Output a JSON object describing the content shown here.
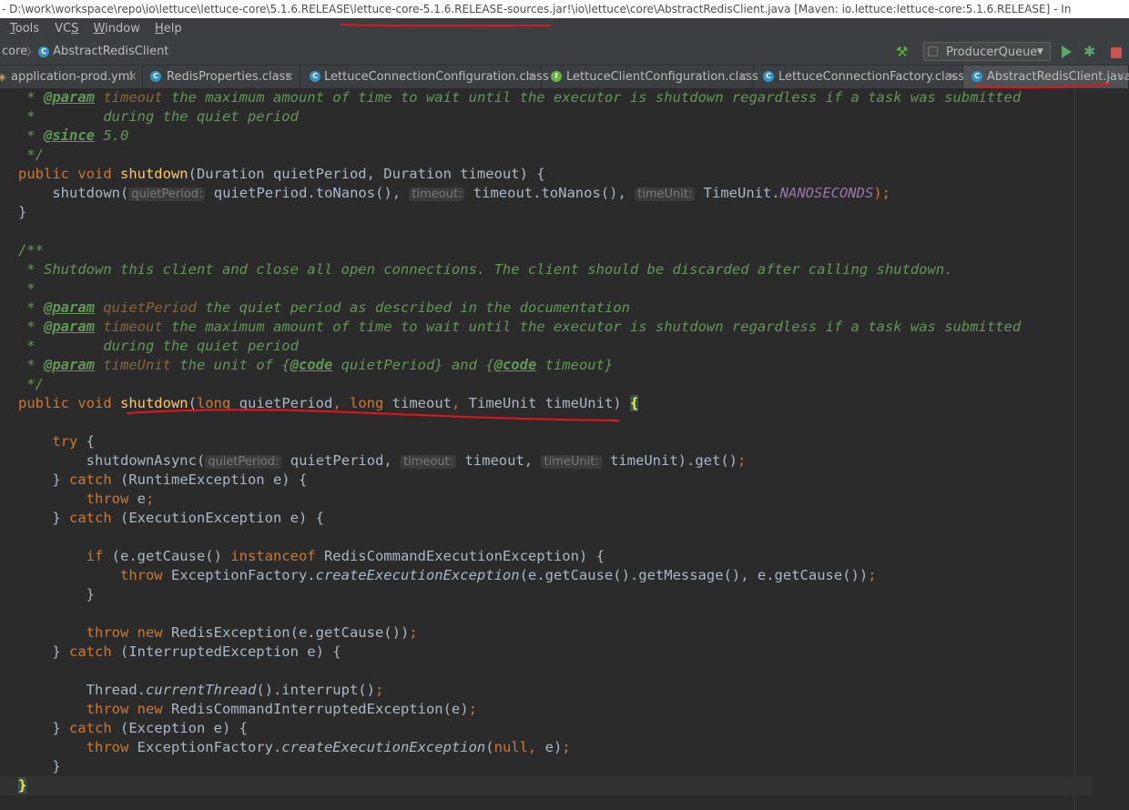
{
  "window": {
    "title": "- D:\\work\\workspace\\repo\\io\\lettuce\\lettuce-core\\5.1.6.RELEASE\\lettuce-core-5.1.6.RELEASE-sources.jar!\\io\\lettuce\\core\\AbstractRedisClient.java [Maven: io.lettuce:lettuce-core:5.1.6.RELEASE] - In"
  },
  "menu": {
    "items": [
      {
        "mnemonic": "T",
        "rest": "ools"
      },
      {
        "mnemonic": "",
        "rest": "VC",
        "tail": "S",
        "tail_underlined": true
      },
      {
        "mnemonic": "W",
        "rest": "indow"
      },
      {
        "mnemonic": "H",
        "rest": "elp"
      }
    ]
  },
  "navbar": {
    "crumb_project": "core",
    "crumb_separator": "〉",
    "crumb_class": "AbstractRedisClient",
    "run_config": "ProducerQueue"
  },
  "tabs": [
    {
      "label": "application-prod.yml",
      "active": false,
      "icon": "yaml-icon"
    },
    {
      "label": "RedisProperties.class",
      "active": false,
      "icon": "class-icon"
    },
    {
      "label": "LettuceConnectionConfiguration.class",
      "active": false,
      "icon": "class-icon"
    },
    {
      "label": "LettuceClientConfiguration.class",
      "active": false,
      "icon": "interface-icon"
    },
    {
      "label": "LettuceConnectionFactory.class",
      "active": false,
      "icon": "class-icon"
    },
    {
      "label": "AbstractRedisClient.java",
      "active": true,
      "icon": "class-icon"
    }
  ],
  "tab_close_glyph": "×",
  "code": [
    [
      {
        "t": " * ",
        "c": "doc"
      },
      {
        "t": "@param",
        "c": "tag"
      },
      {
        "t": " ",
        "c": "doc"
      },
      {
        "t": "timeout",
        "c": "param"
      },
      {
        "t": " the maximum amount of time to wait until the executor is shutdown regardless if a task was submitted",
        "c": "doc"
      }
    ],
    [
      {
        "t": " *        during the quiet period",
        "c": "doc"
      }
    ],
    [
      {
        "t": " * ",
        "c": "doc"
      },
      {
        "t": "@since",
        "c": "tag"
      },
      {
        "t": " 5.0",
        "c": "doc"
      }
    ],
    [
      {
        "t": " */",
        "c": "doc"
      }
    ],
    [
      {
        "t": "public void ",
        "c": "kw"
      },
      {
        "t": "shutdown",
        "c": "method"
      },
      {
        "t": "(Duration quietPeriod, Duration timeout) {",
        "c": "plain"
      }
    ],
    [
      {
        "t": "    shutdown(",
        "c": "plain"
      },
      {
        "t": "quietPeriod:",
        "c": "hint"
      },
      {
        "t": " quietPeriod.toNanos(), ",
        "c": "plain"
      },
      {
        "t": "timeout:",
        "c": "hint"
      },
      {
        "t": " timeout.toNanos(), ",
        "c": "plain"
      },
      {
        "t": "timeUnit:",
        "c": "hint"
      },
      {
        "t": " TimeUnit.",
        "c": "plain"
      },
      {
        "t": "NANOSECONDS",
        "c": "static"
      },
      {
        "t": ");",
        "c": "kw"
      }
    ],
    [
      {
        "t": "}",
        "c": "plain"
      }
    ],
    [
      {
        "t": "",
        "c": "plain"
      }
    ],
    [
      {
        "t": "/**",
        "c": "doc"
      }
    ],
    [
      {
        "t": " * Shutdown this client and close all open connections. The client should be discarded after calling shutdown.",
        "c": "doc"
      }
    ],
    [
      {
        "t": " *",
        "c": "doc"
      }
    ],
    [
      {
        "t": " * ",
        "c": "doc"
      },
      {
        "t": "@param",
        "c": "tag"
      },
      {
        "t": " ",
        "c": "doc"
      },
      {
        "t": "quietPeriod",
        "c": "param"
      },
      {
        "t": " the quiet period as described in the documentation",
        "c": "doc"
      }
    ],
    [
      {
        "t": " * ",
        "c": "doc"
      },
      {
        "t": "@param",
        "c": "tag"
      },
      {
        "t": " ",
        "c": "doc"
      },
      {
        "t": "timeout",
        "c": "param"
      },
      {
        "t": " the maximum amount of time to wait until the executor is shutdown regardless if a task was submitted",
        "c": "doc"
      }
    ],
    [
      {
        "t": " *        during the quiet period",
        "c": "doc"
      }
    ],
    [
      {
        "t": " * ",
        "c": "doc"
      },
      {
        "t": "@param",
        "c": "tag"
      },
      {
        "t": " ",
        "c": "doc"
      },
      {
        "t": "timeUnit",
        "c": "param"
      },
      {
        "t": " the unit of {",
        "c": "doc"
      },
      {
        "t": "@code",
        "c": "tag"
      },
      {
        "t": " quietPeriod} and {",
        "c": "doc"
      },
      {
        "t": "@code",
        "c": "tag"
      },
      {
        "t": " timeout}",
        "c": "doc"
      }
    ],
    [
      {
        "t": " */",
        "c": "doc"
      }
    ],
    [
      {
        "t": "public void ",
        "c": "kw"
      },
      {
        "t": "shutdown",
        "c": "method"
      },
      {
        "t": "(",
        "c": "plain"
      },
      {
        "t": "long ",
        "c": "kw"
      },
      {
        "t": "quietPeriod",
        "c": "plain"
      },
      {
        "t": ", ",
        "c": "kw"
      },
      {
        "t": "long ",
        "c": "kw"
      },
      {
        "t": "timeout",
        "c": "plain"
      },
      {
        "t": ", ",
        "c": "kw"
      },
      {
        "t": "TimeUnit timeUnit) ",
        "c": "plain"
      },
      {
        "t": "{",
        "c": "brace"
      }
    ],
    [
      {
        "t": "",
        "c": "plain"
      }
    ],
    [
      {
        "t": "    ",
        "c": "plain"
      },
      {
        "t": "try ",
        "c": "kw"
      },
      {
        "t": "{",
        "c": "plain"
      }
    ],
    [
      {
        "t": "        shutdownAsync(",
        "c": "plain"
      },
      {
        "t": "quietPeriod:",
        "c": "hint"
      },
      {
        "t": " quietPeriod, ",
        "c": "plain"
      },
      {
        "t": "timeout:",
        "c": "hint"
      },
      {
        "t": " timeout, ",
        "c": "plain"
      },
      {
        "t": "timeUnit:",
        "c": "hint"
      },
      {
        "t": " timeUnit).get()",
        "c": "plain"
      },
      {
        "t": ";",
        "c": "kw"
      }
    ],
    [
      {
        "t": "    } ",
        "c": "plain"
      },
      {
        "t": "catch ",
        "c": "kw"
      },
      {
        "t": "(RuntimeException e) {",
        "c": "plain"
      }
    ],
    [
      {
        "t": "        ",
        "c": "plain"
      },
      {
        "t": "throw ",
        "c": "kw"
      },
      {
        "t": "e",
        "c": "plain"
      },
      {
        "t": ";",
        "c": "kw"
      }
    ],
    [
      {
        "t": "    } ",
        "c": "plain"
      },
      {
        "t": "catch ",
        "c": "kw"
      },
      {
        "t": "(ExecutionException e) {",
        "c": "plain"
      }
    ],
    [
      {
        "t": "",
        "c": "plain"
      }
    ],
    [
      {
        "t": "        ",
        "c": "plain"
      },
      {
        "t": "if ",
        "c": "kw"
      },
      {
        "t": "(e.getCause() ",
        "c": "plain"
      },
      {
        "t": "instanceof ",
        "c": "kw"
      },
      {
        "t": "RedisCommandExecutionException) {",
        "c": "plain"
      }
    ],
    [
      {
        "t": "            ",
        "c": "plain"
      },
      {
        "t": "throw ",
        "c": "kw"
      },
      {
        "t": "ExceptionFactory.",
        "c": "plain"
      },
      {
        "t": "createExecutionException",
        "c": "italic"
      },
      {
        "t": "(e.getCause().getMessage(), e.getCause())",
        "c": "plain"
      },
      {
        "t": ";",
        "c": "kw"
      }
    ],
    [
      {
        "t": "        }",
        "c": "plain"
      }
    ],
    [
      {
        "t": "",
        "c": "plain"
      }
    ],
    [
      {
        "t": "        ",
        "c": "plain"
      },
      {
        "t": "throw new ",
        "c": "kw"
      },
      {
        "t": "RedisException(e.getCause())",
        "c": "plain"
      },
      {
        "t": ";",
        "c": "kw"
      }
    ],
    [
      {
        "t": "    } ",
        "c": "plain"
      },
      {
        "t": "catch ",
        "c": "kw"
      },
      {
        "t": "(InterruptedException e) {",
        "c": "plain"
      }
    ],
    [
      {
        "t": "",
        "c": "plain"
      }
    ],
    [
      {
        "t": "        Thread.",
        "c": "plain"
      },
      {
        "t": "currentThread",
        "c": "italic"
      },
      {
        "t": "().interrupt()",
        "c": "plain"
      },
      {
        "t": ";",
        "c": "kw"
      }
    ],
    [
      {
        "t": "        ",
        "c": "plain"
      },
      {
        "t": "throw new ",
        "c": "kw"
      },
      {
        "t": "RedisCommandInterruptedException(e)",
        "c": "plain"
      },
      {
        "t": ";",
        "c": "kw"
      }
    ],
    [
      {
        "t": "    } ",
        "c": "plain"
      },
      {
        "t": "catch ",
        "c": "kw"
      },
      {
        "t": "(Exception e) {",
        "c": "plain"
      }
    ],
    [
      {
        "t": "        ",
        "c": "plain"
      },
      {
        "t": "throw ",
        "c": "kw"
      },
      {
        "t": "ExceptionFactory.",
        "c": "plain"
      },
      {
        "t": "createExecutionException",
        "c": "italic"
      },
      {
        "t": "(",
        "c": "plain"
      },
      {
        "t": "null, ",
        "c": "kw"
      },
      {
        "t": "e)",
        "c": "plain"
      },
      {
        "t": ";",
        "c": "kw"
      }
    ],
    [
      {
        "t": "    }",
        "c": "plain"
      }
    ],
    [
      {
        "t": "}",
        "c": "brace"
      }
    ]
  ],
  "colors": {
    "editor_bg": "#2b2b2b",
    "keyword": "#cc7832",
    "method_decl": "#ffc66d",
    "javadoc": "#629755",
    "annotation_ink": "#e8141b"
  }
}
